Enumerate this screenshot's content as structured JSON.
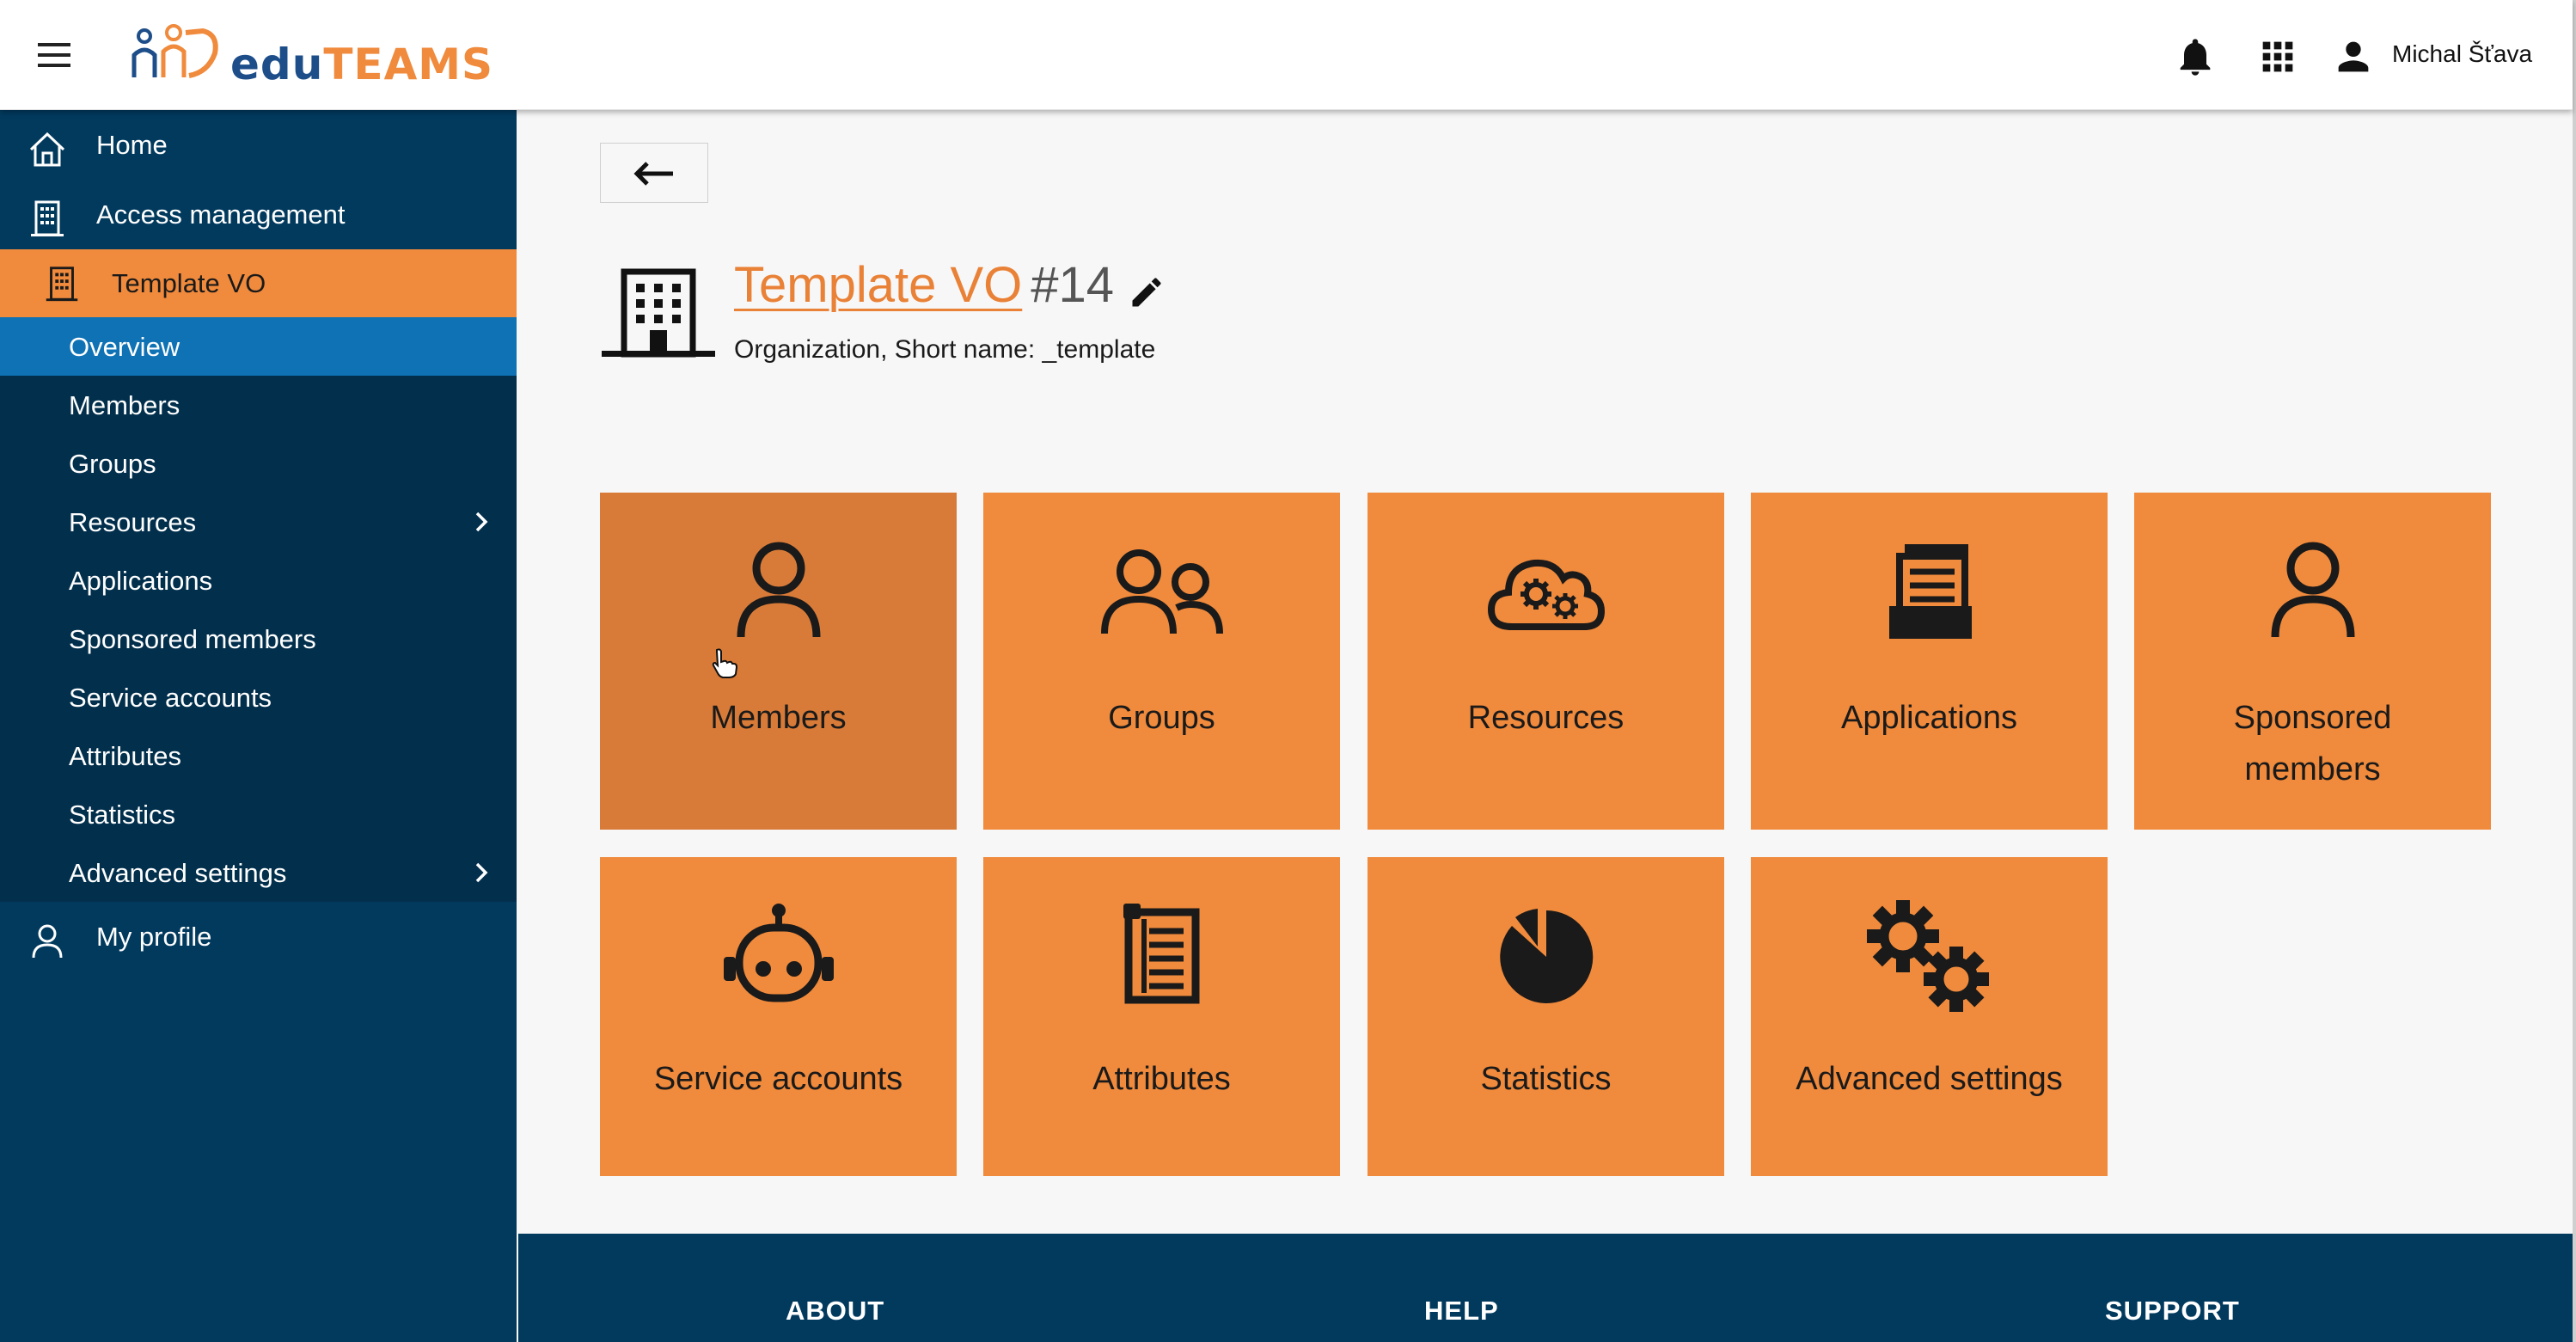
{
  "header": {
    "logo_text_a": "edu",
    "logo_text_b": "TEAMS",
    "user_name": "Michal Šťava",
    "icons": [
      "menu-icon",
      "bell-icon",
      "apps-grid-icon",
      "account-icon"
    ]
  },
  "sidebar": {
    "home": "Home",
    "access_management": "Access management",
    "template_vo": "Template VO",
    "sub_items": [
      {
        "label": "Overview",
        "active": true
      },
      {
        "label": "Members"
      },
      {
        "label": "Groups"
      },
      {
        "label": "Resources",
        "has_children": true
      },
      {
        "label": "Applications"
      },
      {
        "label": "Sponsored members"
      },
      {
        "label": "Service accounts"
      },
      {
        "label": "Attributes"
      },
      {
        "label": "Statistics"
      },
      {
        "label": "Advanced settings",
        "has_children": true
      }
    ],
    "my_profile": "My profile"
  },
  "main": {
    "vo_name": "Template VO",
    "vo_id": "#14",
    "vo_subtitle": "Organization, Short name: _template",
    "tiles": [
      {
        "label": "Members",
        "icon": "person-icon"
      },
      {
        "label": "Groups",
        "icon": "people-icon"
      },
      {
        "label": "Resources",
        "icon": "cloud-gears-icon"
      },
      {
        "label": "Applications",
        "icon": "documents-tray-icon"
      },
      {
        "label": "Sponsored\nmembers",
        "icon": "person-icon"
      },
      {
        "label": "Service accounts",
        "icon": "robot-icon"
      },
      {
        "label": "Attributes",
        "icon": "notepad-list-icon"
      },
      {
        "label": "Statistics",
        "icon": "pie-chart-icon"
      },
      {
        "label": "Advanced settings",
        "icon": "gears-icon"
      }
    ]
  },
  "footer": {
    "about": "ABOUT",
    "help": "HELP",
    "support": "SUPPORT"
  },
  "colors": {
    "brand_orange": "#f08a3c",
    "sidebar_blue": "#023a5e",
    "active_blue": "#0e72b5"
  }
}
